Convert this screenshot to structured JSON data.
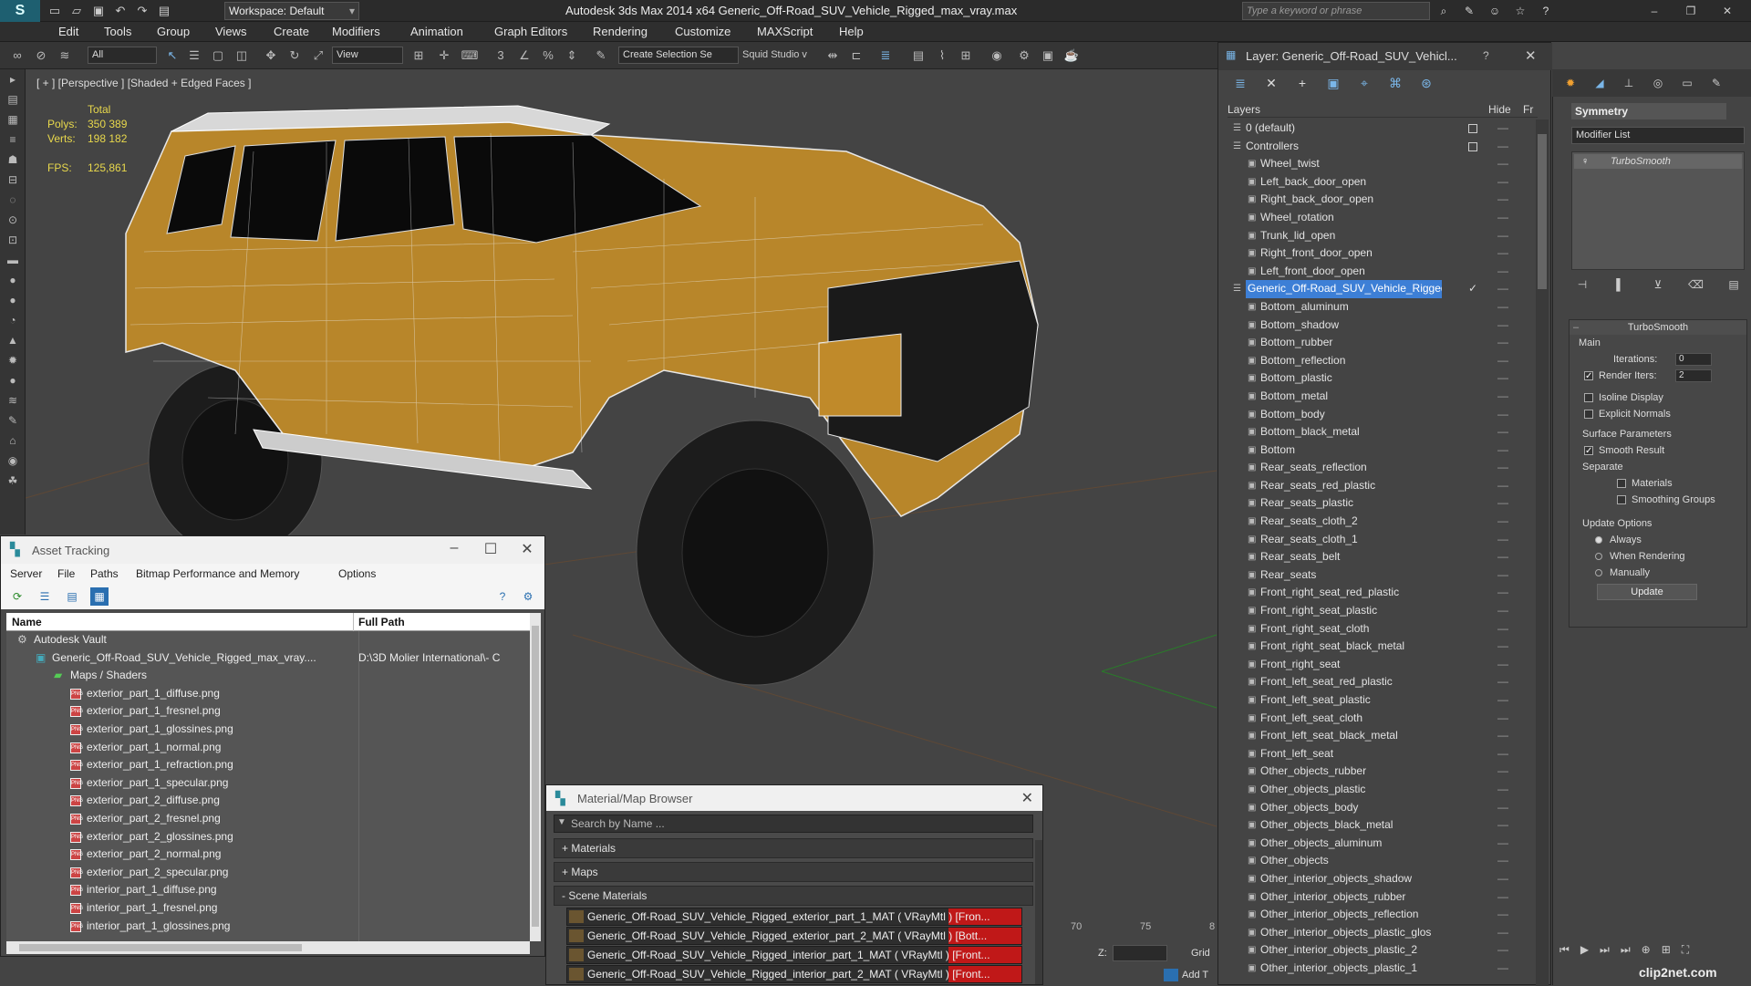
{
  "titlebar": {
    "logo": "S",
    "workspace": "Workspace: Default",
    "title": "Autodesk 3ds Max  2014 x64      Generic_Off-Road_SUV_Vehicle_Rigged_max_vray.max",
    "search_placeholder": "Type a keyword or phrase"
  },
  "menu": [
    "Edit",
    "Tools",
    "Group",
    "Views",
    "Create",
    "Modifiers",
    "Animation",
    "Graph Editors",
    "Rendering",
    "Customize",
    "MAXScript",
    "Help"
  ],
  "toolbar": {
    "filter": "All",
    "ref_coord": "View",
    "selection_set": "Create Selection Se",
    "squid": "Squid Studio v"
  },
  "viewport": {
    "label": "[ + ] [Perspective ] [Shaded + Edged Faces ]",
    "stats_total": "Total",
    "polys_label": "Polys:",
    "polys_value": "350 389",
    "verts_label": "Verts:",
    "verts_value": "198 182",
    "fps_label": "FPS:",
    "fps_value": "125,861"
  },
  "layer_window": {
    "title": "Layer: Generic_Off-Road_SUV_Vehicl...",
    "help": "?",
    "col_layers": "Layers",
    "col_hide": "Hide",
    "col_fr": "Fr",
    "rows": [
      {
        "name": "0 (default)",
        "level": 1,
        "box": true
      },
      {
        "name": "Controllers",
        "level": 1,
        "box": true
      },
      {
        "name": "Wheel_twist",
        "level": 2
      },
      {
        "name": "Left_back_door_open",
        "level": 2
      },
      {
        "name": "Right_back_door_open",
        "level": 2
      },
      {
        "name": "Wheel_rotation",
        "level": 2
      },
      {
        "name": "Trunk_lid_open",
        "level": 2
      },
      {
        "name": "Right_front_door_open",
        "level": 2
      },
      {
        "name": "Left_front_door_open",
        "level": 2
      },
      {
        "name": "Generic_Off-Road_SUV_Vehicle_Rigged",
        "level": 1,
        "selected": true
      },
      {
        "name": "Bottom_aluminum",
        "level": 2
      },
      {
        "name": "Bottom_shadow",
        "level": 2
      },
      {
        "name": "Bottom_rubber",
        "level": 2
      },
      {
        "name": "Bottom_reflection",
        "level": 2
      },
      {
        "name": "Bottom_plastic",
        "level": 2
      },
      {
        "name": "Bottom_metal",
        "level": 2
      },
      {
        "name": "Bottom_body",
        "level": 2
      },
      {
        "name": "Bottom_black_metal",
        "level": 2
      },
      {
        "name": "Bottom",
        "level": 2
      },
      {
        "name": "Rear_seats_reflection",
        "level": 2
      },
      {
        "name": "Rear_seats_red_plastic",
        "level": 2
      },
      {
        "name": "Rear_seats_plastic",
        "level": 2
      },
      {
        "name": "Rear_seats_cloth_2",
        "level": 2
      },
      {
        "name": "Rear_seats_cloth_1",
        "level": 2
      },
      {
        "name": "Rear_seats_belt",
        "level": 2
      },
      {
        "name": "Rear_seats",
        "level": 2
      },
      {
        "name": "Front_right_seat_red_plastic",
        "level": 2
      },
      {
        "name": "Front_right_seat_plastic",
        "level": 2
      },
      {
        "name": "Front_right_seat_cloth",
        "level": 2
      },
      {
        "name": "Front_right_seat_black_metal",
        "level": 2
      },
      {
        "name": "Front_right_seat",
        "level": 2
      },
      {
        "name": "Front_left_seat_red_plastic",
        "level": 2
      },
      {
        "name": "Front_left_seat_plastic",
        "level": 2
      },
      {
        "name": "Front_left_seat_cloth",
        "level": 2
      },
      {
        "name": "Front_left_seat_black_metal",
        "level": 2
      },
      {
        "name": "Front_left_seat",
        "level": 2
      },
      {
        "name": "Other_objects_rubber",
        "level": 2
      },
      {
        "name": "Other_objects_plastic",
        "level": 2
      },
      {
        "name": "Other_objects_body",
        "level": 2
      },
      {
        "name": "Other_objects_black_metal",
        "level": 2
      },
      {
        "name": "Other_objects_aluminum",
        "level": 2
      },
      {
        "name": "Other_objects",
        "level": 2
      },
      {
        "name": "Other_interior_objects_shadow",
        "level": 2
      },
      {
        "name": "Other_interior_objects_rubber",
        "level": 2
      },
      {
        "name": "Other_interior_objects_reflection",
        "level": 2
      },
      {
        "name": "Other_interior_objects_plastic_glos",
        "level": 2
      },
      {
        "name": "Other_interior_objects_plastic_2",
        "level": 2
      },
      {
        "name": "Other_interior_objects_plastic_1",
        "level": 2
      }
    ]
  },
  "command_panel": {
    "object_name": "Symmetry",
    "modifier_list": "Modifier List",
    "stack_item": "TurboSmooth",
    "rollout_title": "TurboSmooth",
    "main": "Main",
    "iterations_label": "Iterations:",
    "iterations_value": "0",
    "render_iters_label": "Render Iters:",
    "render_iters_value": "2",
    "isoline": "Isoline Display",
    "explicit_normals": "Explicit Normals",
    "surface_params": "Surface Parameters",
    "smooth_result": "Smooth Result",
    "separate": "Separate",
    "materials": "Materials",
    "smoothing_groups": "Smoothing Groups",
    "update_options": "Update Options",
    "always": "Always",
    "when_rendering": "When Rendering",
    "manually": "Manually",
    "update": "Update"
  },
  "asset_tracking": {
    "title": "Asset Tracking",
    "menu": [
      "Server",
      "File",
      "Paths",
      "Bitmap Performance and Memory",
      "Options"
    ],
    "col_name": "Name",
    "col_path": "Full Path",
    "rows": [
      {
        "name": "Autodesk Vault",
        "indent": 30,
        "path": "",
        "kind": "vault"
      },
      {
        "name": "Generic_Off-Road_SUV_Vehicle_Rigged_max_vray....",
        "indent": 50,
        "path": "D:\\3D Molier International\\- C",
        "kind": "max"
      },
      {
        "name": "Maps / Shaders",
        "indent": 70,
        "path": "",
        "kind": "folder"
      },
      {
        "name": "exterior_part_1_diffuse.png",
        "indent": 88,
        "path": "",
        "kind": "png"
      },
      {
        "name": "exterior_part_1_fresnel.png",
        "indent": 88,
        "path": "",
        "kind": "png"
      },
      {
        "name": "exterior_part_1_glossines.png",
        "indent": 88,
        "path": "",
        "kind": "png"
      },
      {
        "name": "exterior_part_1_normal.png",
        "indent": 88,
        "path": "",
        "kind": "png"
      },
      {
        "name": "exterior_part_1_refraction.png",
        "indent": 88,
        "path": "",
        "kind": "png"
      },
      {
        "name": "exterior_part_1_specular.png",
        "indent": 88,
        "path": "",
        "kind": "png"
      },
      {
        "name": "exterior_part_2_diffuse.png",
        "indent": 88,
        "path": "",
        "kind": "png"
      },
      {
        "name": "exterior_part_2_fresnel.png",
        "indent": 88,
        "path": "",
        "kind": "png"
      },
      {
        "name": "exterior_part_2_glossines.png",
        "indent": 88,
        "path": "",
        "kind": "png"
      },
      {
        "name": "exterior_part_2_normal.png",
        "indent": 88,
        "path": "",
        "kind": "png"
      },
      {
        "name": "exterior_part_2_specular.png",
        "indent": 88,
        "path": "",
        "kind": "png"
      },
      {
        "name": "interior_part_1_diffuse.png",
        "indent": 88,
        "path": "",
        "kind": "png"
      },
      {
        "name": "interior_part_1_fresnel.png",
        "indent": 88,
        "path": "",
        "kind": "png"
      },
      {
        "name": "interior_part_1_glossines.png",
        "indent": 88,
        "path": "",
        "kind": "png"
      }
    ]
  },
  "material_browser": {
    "title": "Material/Map Browser",
    "search": "Search by Name ...",
    "sec_materials": "+ Materials",
    "sec_maps": "+ Maps",
    "sec_scene": "- Scene Materials",
    "items": [
      "Generic_Off-Road_SUV_Vehicle_Rigged_exterior_part_1_MAT ( VRayMtl ) [Fron...",
      "Generic_Off-Road_SUV_Vehicle_Rigged_exterior_part_2_MAT ( VRayMtl ) [Bott...",
      "Generic_Off-Road_SUV_Vehicle_Rigged_interior_part_1_MAT ( VRayMtl ) [Front...",
      "Generic_Off-Road_SUV_Vehicle_Rigged_interior_part_2_MAT ( VRayMtl ) [Front..."
    ]
  },
  "timeline": {
    "t70": "70",
    "t75": "75",
    "t80": "8"
  },
  "status": {
    "z_label": "Z:",
    "grid_label": "Grid",
    "add_label": "Add T"
  },
  "watermark": "clip2net.com",
  "colors": {
    "accent": "#3d7fd6",
    "body": "#b8862a",
    "red": "#c01818"
  }
}
